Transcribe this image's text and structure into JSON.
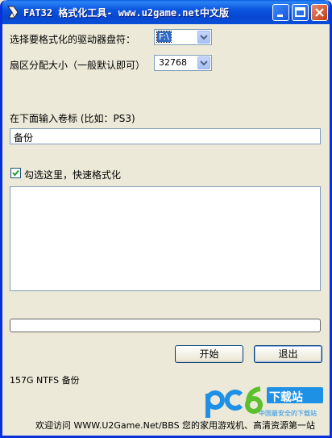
{
  "window": {
    "title": "FAT32 格式化工具- www.u2game.net中文版",
    "title_icon": "app-icon",
    "buttons": [
      "minimize-icon",
      "maximize-icon",
      "close-icon"
    ]
  },
  "drive": {
    "label": "选择要格式化的驱动器盘符：",
    "value": "F:\\"
  },
  "cluster": {
    "label": "扇区分配大小（一般默认即可）",
    "value": "32768"
  },
  "volume": {
    "label": "在下面输入卷标 (比如：PS3)",
    "value": "备份"
  },
  "quick_format": {
    "label": "勾选这里，快速格式化",
    "checked": true
  },
  "log": {
    "text": ""
  },
  "progress": {
    "percent": 0
  },
  "actions": {
    "start_label": "开始",
    "exit_label": "退出"
  },
  "status": {
    "text": "157G NTFS 备份"
  },
  "footer": {
    "text": "欢迎访问 WWW.U2Game.Net/BBS 您的家用游戏机、高清资源第一站"
  },
  "watermark": {
    "logo": "pc6",
    "tagline": "下载站",
    "subline": "中国最安全的下载站"
  },
  "colors": {
    "titlebar": "#0b55e0",
    "window_bg": "#ece9d8",
    "watermark_blue": "#1e90e6",
    "watermark_green": "#5cc02e"
  }
}
